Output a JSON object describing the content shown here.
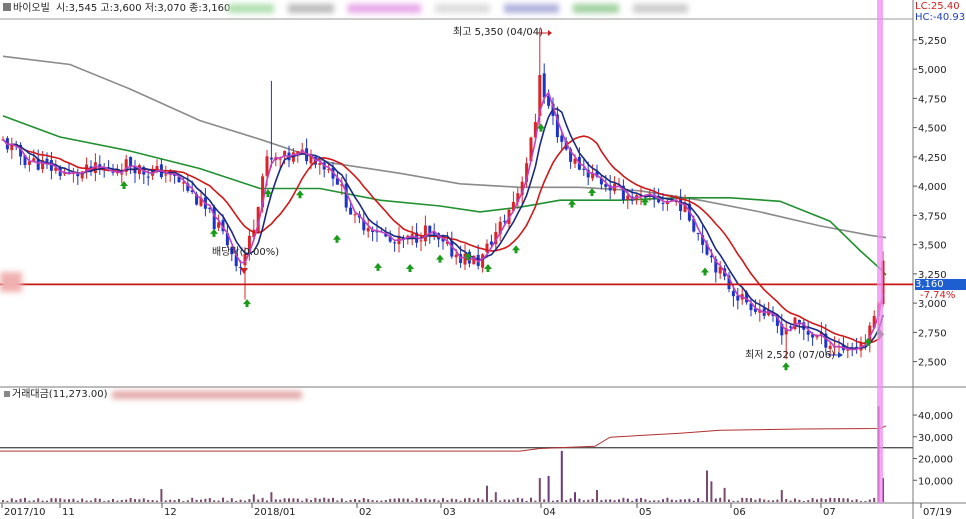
{
  "header": {
    "stock_name": "바이오빌",
    "ohlc_text": "시:3,545 고:3,600 저:3,070 종:3,160",
    "lc_text": "LC:25.40",
    "hc_text": "HC:-40.93"
  },
  "volume_header": {
    "title": "거래대금(11,273.00)"
  },
  "annotations": {
    "high": "최고 5,350 (04/04)",
    "low": "최저 2,520 (07/06)",
    "mid": "배당락(0.00%)"
  },
  "current_price_label": "3,160",
  "current_change_label": "-7.74%",
  "colors": {
    "up": "#d92525",
    "down": "#1c34c8",
    "ma5": "#c040c0",
    "ma10": "#1a2a80",
    "ma20": "#d01818",
    "ma60": "#209030",
    "ma120": "#8a8a8a",
    "cursor": "#f08cf0",
    "support": "#c81414",
    "signal": "#1a9c1a"
  },
  "chart_data": {
    "type": "candlestick",
    "y_ticks": [
      "5,250",
      "5,000",
      "4,750",
      "4,500",
      "4,250",
      "4,000",
      "3,750",
      "3,500",
      "3,250",
      "3,000",
      "2,750",
      "2,500"
    ],
    "y_tick_values": [
      5250,
      5000,
      4750,
      4500,
      4250,
      4000,
      3750,
      3500,
      3250,
      3000,
      2750,
      2500
    ],
    "ylim": [
      2300,
      5420
    ],
    "volume_ticks": [
      "40,000",
      "30,000",
      "20,000",
      "10,000"
    ],
    "volume_tick_values": [
      40000,
      30000,
      20000,
      10000
    ],
    "volume_ylim": [
      0,
      46000
    ],
    "x_ticks": [
      "2017/10",
      "11",
      "12",
      "2018/01",
      "02",
      "03",
      "04",
      "05",
      "06",
      "07",
      "07/19"
    ],
    "support_price": 3160,
    "volume_reference_level": 25000,
    "dates_span": "2017/10 - 2018/07/19",
    "high_point": 5350,
    "low_point": 2520,
    "series": [
      {
        "name": "MA5"
      },
      {
        "name": "MA10"
      },
      {
        "name": "MA20"
      },
      {
        "name": "MA60"
      },
      {
        "name": "MA120"
      }
    ]
  }
}
